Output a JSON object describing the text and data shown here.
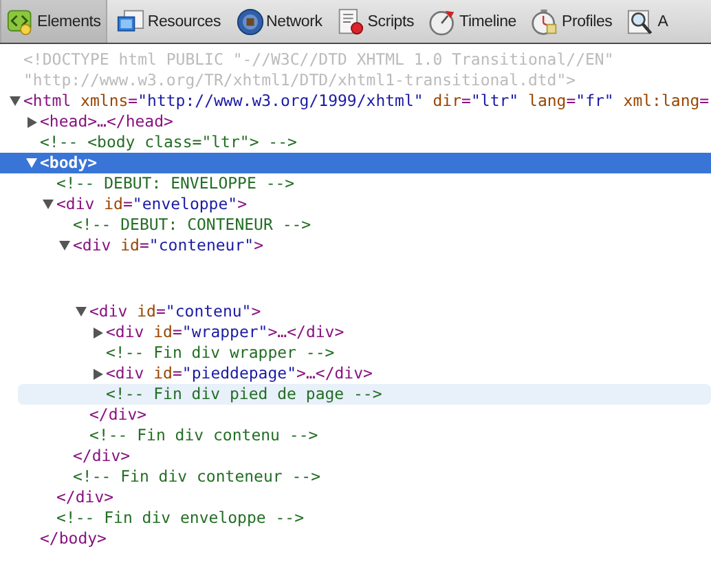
{
  "toolbar": {
    "tabs": [
      {
        "label": "Elements",
        "selected": true
      },
      {
        "label": "Resources",
        "selected": false
      },
      {
        "label": "Network",
        "selected": false
      },
      {
        "label": "Scripts",
        "selected": false
      },
      {
        "label": "Timeline",
        "selected": false
      },
      {
        "label": "Profiles",
        "selected": false
      },
      {
        "label": "A",
        "selected": false
      }
    ]
  },
  "tree": [
    {
      "kind": "doctype",
      "selected": false,
      "hovered": false,
      "lines": [
        [
          {
            "kind": "doctype",
            "t": "<!DOCTYPE html PUBLIC \"-//W3C//DTD XHTML 1.0 Transitional//EN\""
          }
        ],
        [
          {
            "kind": "doctype",
            "t": "\"http://www.w3.org/TR/xhtml1/DTD/xhtml1-transitional.dtd\">"
          }
        ]
      ]
    },
    {
      "kind": "element",
      "expanded": true,
      "selected": false,
      "hovered": false,
      "lines": [
        [
          {
            "kind": "tag",
            "t": "<html"
          },
          {
            "kind": "attr",
            "t": " xmlns"
          },
          {
            "kind": "tag",
            "t": "="
          },
          {
            "kind": "value",
            "t": "\"http://www.w3.org/1999/xhtml\""
          },
          {
            "kind": "attr",
            "t": " dir"
          },
          {
            "kind": "tag",
            "t": "="
          },
          {
            "kind": "value",
            "t": "\"ltr\""
          },
          {
            "kind": "attr",
            "t": " lang"
          },
          {
            "kind": "tag",
            "t": "="
          },
          {
            "kind": "value",
            "t": "\"fr\""
          },
          {
            "kind": "attr",
            "t": " xml:lang"
          },
          {
            "kind": "tag",
            "t": "="
          }
        ]
      ],
      "children": [
        {
          "kind": "element",
          "expanded": false,
          "selected": false,
          "hovered": false,
          "lines": [
            [
              {
                "kind": "tag",
                "t": "<head>"
              },
              {
                "kind": "tag",
                "t": "…"
              },
              {
                "kind": "tag",
                "t": "</head>"
              }
            ]
          ]
        },
        {
          "kind": "comment",
          "selected": false,
          "hovered": false,
          "lines": [
            [
              {
                "kind": "comment",
                "t": "<!-- <body class=\"ltr\"> -->"
              }
            ]
          ]
        },
        {
          "kind": "element",
          "expanded": true,
          "selected": true,
          "hovered": false,
          "lines": [
            [
              {
                "kind": "tag",
                "t": "<body>"
              }
            ]
          ],
          "close": [
            {
              "kind": "tag",
              "t": "</body>"
            }
          ],
          "children": [
            {
              "kind": "comment",
              "selected": false,
              "hovered": false,
              "lines": [
                [
                  {
                    "kind": "comment",
                    "t": "<!-- DEBUT: ENVELOPPE -->"
                  }
                ]
              ]
            },
            {
              "kind": "element",
              "expanded": true,
              "selected": false,
              "hovered": false,
              "lines": [
                [
                  {
                    "kind": "tag",
                    "t": "<div"
                  },
                  {
                    "kind": "attr",
                    "t": " id"
                  },
                  {
                    "kind": "tag",
                    "t": "="
                  },
                  {
                    "kind": "value",
                    "t": "\"enveloppe\""
                  },
                  {
                    "kind": "tag",
                    "t": ">"
                  }
                ]
              ],
              "close": [
                {
                  "kind": "tag",
                  "t": "</div>"
                }
              ],
              "children": [
                {
                  "kind": "comment",
                  "selected": false,
                  "hovered": false,
                  "lines": [
                    [
                      {
                        "kind": "comment",
                        "t": "<!-- DEBUT: CONTENEUR -->"
                      }
                    ]
                  ]
                },
                {
                  "kind": "element",
                  "expanded": true,
                  "selected": false,
                  "hovered": false,
                  "lines": [
                    [
                      {
                        "kind": "tag",
                        "t": "<div"
                      },
                      {
                        "kind": "attr",
                        "t": " id"
                      },
                      {
                        "kind": "tag",
                        "t": "="
                      },
                      {
                        "kind": "value",
                        "t": "\"conteneur\""
                      },
                      {
                        "kind": "tag",
                        "t": ">"
                      }
                    ]
                  ],
                  "close": [
                    {
                      "kind": "tag",
                      "t": "</div>"
                    }
                  ],
                  "children": [
                    {
                      "kind": "gap"
                    },
                    {
                      "kind": "element",
                      "expanded": true,
                      "selected": false,
                      "hovered": false,
                      "lines": [
                        [
                          {
                            "kind": "tag",
                            "t": "<div"
                          },
                          {
                            "kind": "attr",
                            "t": " id"
                          },
                          {
                            "kind": "tag",
                            "t": "="
                          },
                          {
                            "kind": "value",
                            "t": "\"contenu\""
                          },
                          {
                            "kind": "tag",
                            "t": ">"
                          }
                        ]
                      ],
                      "close": [
                        {
                          "kind": "tag",
                          "t": "</div>"
                        }
                      ],
                      "children": [
                        {
                          "kind": "element",
                          "expanded": false,
                          "selected": false,
                          "hovered": false,
                          "lines": [
                            [
                              {
                                "kind": "tag",
                                "t": "<div"
                              },
                              {
                                "kind": "attr",
                                "t": " id"
                              },
                              {
                                "kind": "tag",
                                "t": "="
                              },
                              {
                                "kind": "value",
                                "t": "\"wrapper\""
                              },
                              {
                                "kind": "tag",
                                "t": ">"
                              },
                              {
                                "kind": "tag",
                                "t": "…"
                              },
                              {
                                "kind": "tag",
                                "t": "</div>"
                              }
                            ]
                          ]
                        },
                        {
                          "kind": "comment",
                          "selected": false,
                          "hovered": false,
                          "lines": [
                            [
                              {
                                "kind": "comment",
                                "t": "<!-- Fin div wrapper -->"
                              }
                            ]
                          ]
                        },
                        {
                          "kind": "element",
                          "expanded": false,
                          "selected": false,
                          "hovered": false,
                          "lines": [
                            [
                              {
                                "kind": "tag",
                                "t": "<div"
                              },
                              {
                                "kind": "attr",
                                "t": " id"
                              },
                              {
                                "kind": "tag",
                                "t": "="
                              },
                              {
                                "kind": "value",
                                "t": "\"pieddepage\""
                              },
                              {
                                "kind": "tag",
                                "t": ">"
                              },
                              {
                                "kind": "tag",
                                "t": "…"
                              },
                              {
                                "kind": "tag",
                                "t": "</div>"
                              }
                            ]
                          ]
                        },
                        {
                          "kind": "comment",
                          "selected": false,
                          "hovered": true,
                          "lines": [
                            [
                              {
                                "kind": "comment",
                                "t": "<!-- Fin div pied de page -->"
                              }
                            ]
                          ]
                        }
                      ]
                    },
                    {
                      "kind": "comment",
                      "selected": false,
                      "hovered": false,
                      "lines": [
                        [
                          {
                            "kind": "comment",
                            "t": "<!-- Fin div contenu -->"
                          }
                        ]
                      ]
                    }
                  ]
                },
                {
                  "kind": "comment",
                  "selected": false,
                  "hovered": false,
                  "lines": [
                    [
                      {
                        "kind": "comment",
                        "t": "<!-- Fin div conteneur -->"
                      }
                    ]
                  ]
                }
              ]
            },
            {
              "kind": "comment",
              "selected": false,
              "hovered": false,
              "lines": [
                [
                  {
                    "kind": "comment",
                    "t": "<!-- Fin div enveloppe -->"
                  }
                ]
              ]
            }
          ]
        }
      ]
    }
  ]
}
